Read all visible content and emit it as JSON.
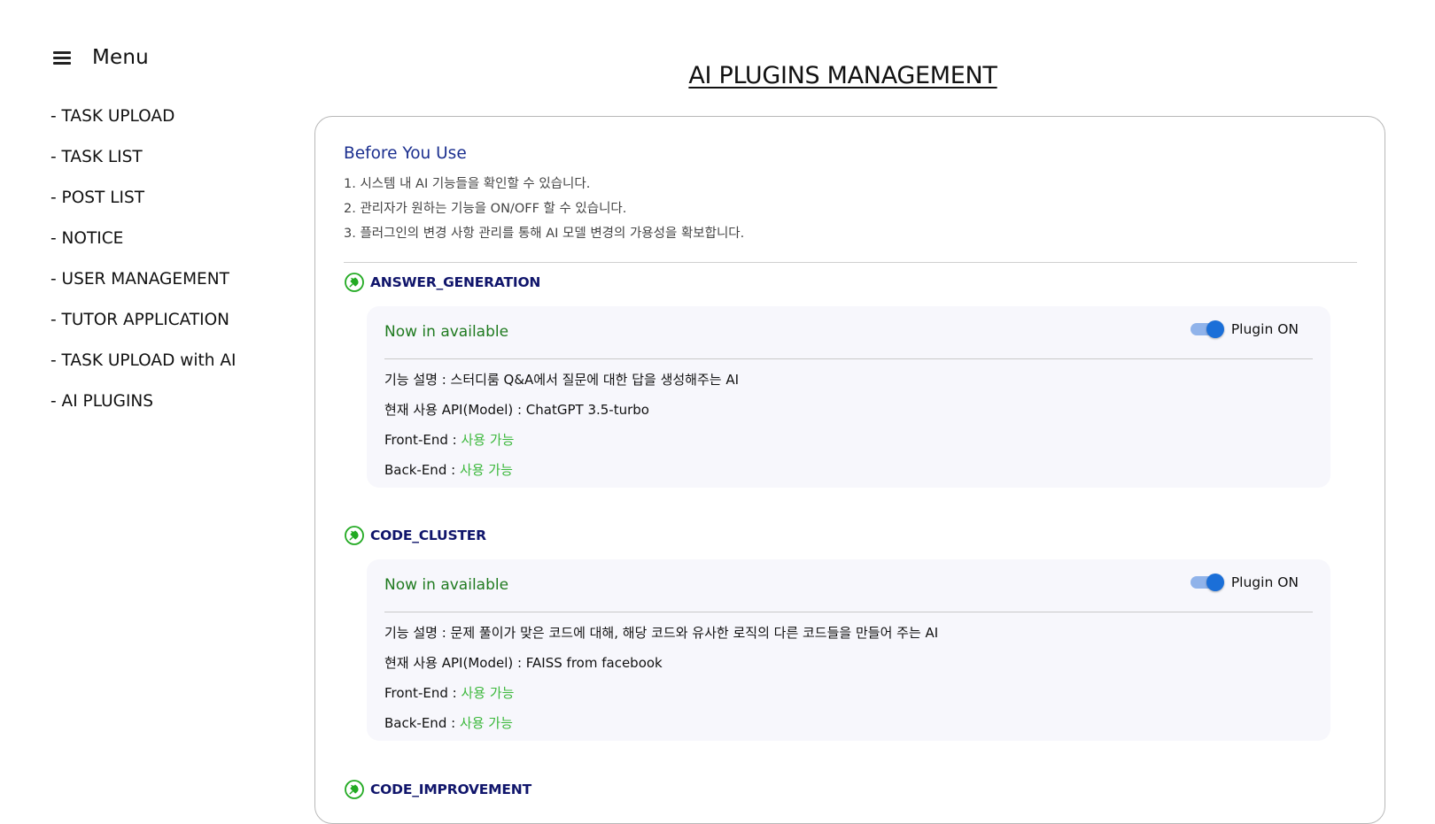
{
  "sidebar": {
    "title": "Menu",
    "items": [
      {
        "label": "- TASK UPLOAD"
      },
      {
        "label": "- TASK LIST"
      },
      {
        "label": "- POST LIST"
      },
      {
        "label": "- NOTICE"
      },
      {
        "label": "- USER MANAGEMENT"
      },
      {
        "label": "- TUTOR APPLICATION"
      },
      {
        "label": "- TASK UPLOAD with AI"
      },
      {
        "label": "- AI PLUGINS"
      }
    ]
  },
  "page": {
    "title": "AI PLUGINS MANAGEMENT"
  },
  "intro": {
    "heading": "Before You Use",
    "lines": [
      "1. 시스템 내 AI 기능들을 확인할 수 있습니다.",
      "2. 관리자가 원하는 기능을 ON/OFF 할 수 있습니다.",
      "3. 플러그인의 변경 사항 관리를 통해 AI 모델 변경의 가용성을 확보합니다."
    ]
  },
  "plugins": [
    {
      "name": "ANSWER_GENERATION",
      "status": "Now in available",
      "toggle_label": "Plugin ON",
      "toggle_on": true,
      "description": "기능 설명 : 스터디룸 Q&A에서 질문에 대한 답을 생성해주는 AI",
      "api": "현재 사용 API(Model) : ChatGPT 3.5-turbo",
      "frontend_label": "Front-End : ",
      "frontend_value": "사용 가능",
      "backend_label": "Back-End : ",
      "backend_value": "사용 가능"
    },
    {
      "name": "CODE_CLUSTER",
      "status": "Now in available",
      "toggle_label": "Plugin ON",
      "toggle_on": true,
      "description": "기능 설명 : 문제 풀이가 맞은 코드에 대해, 해당 코드와 유사한 로직의 다른 코드들을 만들어 주는 AI",
      "api": "현재 사용 API(Model) : FAISS from facebook",
      "frontend_label": "Front-End : ",
      "frontend_value": "사용 가능",
      "backend_label": "Back-End : ",
      "backend_value": "사용 가능"
    },
    {
      "name": "CODE_IMPROVEMENT"
    }
  ],
  "colors": {
    "heading_blue": "#1b2f8f",
    "plugin_name": "#10156b",
    "status_green": "#1f7a1f",
    "available_green": "#3cb83c",
    "toggle_blue": "#1b6fd8",
    "plug_icon_green": "#22aa22"
  },
  "icons": {
    "menu": "hamburger-icon",
    "plugin": "plug-icon"
  }
}
